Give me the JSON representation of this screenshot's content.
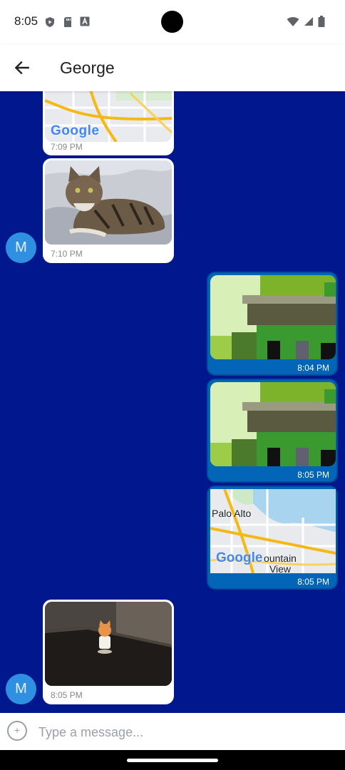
{
  "status_bar": {
    "time": "8:05",
    "left_icons": [
      "shield-play-icon",
      "sd-card-icon",
      "font-a-icon"
    ],
    "right_icons": [
      "wifi-icon",
      "signal-icon",
      "battery-icon"
    ]
  },
  "header": {
    "title": "George",
    "back_icon": "arrow-back-icon"
  },
  "colors": {
    "chat_background": "#00178d",
    "outgoing_bubble": "#0265b8",
    "incoming_bubble": "#ffffff",
    "avatar": "#2f8fe0"
  },
  "messages": [
    {
      "direction": "incoming",
      "type": "map",
      "map_logo": "Google",
      "time": "7:09 PM"
    },
    {
      "direction": "incoming",
      "type": "photo",
      "subject": "cat-photo",
      "time": "7:10 PM",
      "avatar": "M"
    },
    {
      "direction": "outgoing",
      "type": "sticker",
      "time": "8:04 PM"
    },
    {
      "direction": "outgoing",
      "type": "sticker",
      "time": "8:05 PM"
    },
    {
      "direction": "outgoing",
      "type": "map",
      "map_labels": [
        "Palo Alto",
        "ountain View"
      ],
      "map_logo": "Google",
      "time": "8:05 PM"
    },
    {
      "direction": "incoming",
      "type": "photo",
      "subject": "figurine-photo",
      "time": "8:05 PM",
      "avatar": "M"
    }
  ],
  "composer": {
    "placeholder": "Type a message...",
    "value": "",
    "attach_icon": "add-circle-icon"
  }
}
